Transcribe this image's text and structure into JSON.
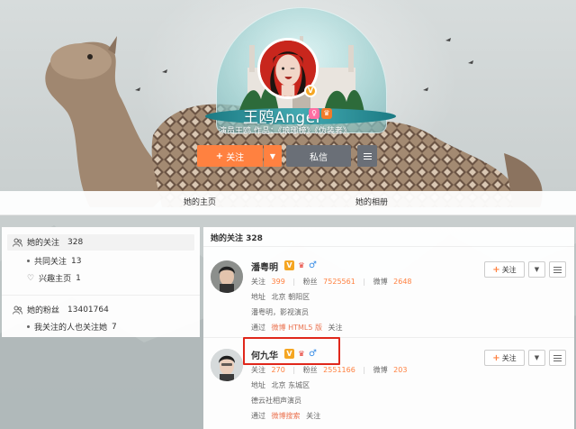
{
  "profile": {
    "name": "王鸥Angel",
    "description": "演员王鸥 作品：《琅琊榜》《伪装者》",
    "follow_label": "关注",
    "follow_plus": "+",
    "message_label": "私信",
    "badge_v": "V"
  },
  "tabs": [
    {
      "label": "她的主页"
    },
    {
      "label": "她的相册"
    }
  ],
  "sidebar": {
    "following_label": "她的关注",
    "following_count": "328",
    "mutual_label": "共同关注",
    "mutual_count": "13",
    "interest_label": "兴趣主页",
    "interest_count": "1",
    "fans_label": "她的粉丝",
    "fans_count": "13401764",
    "fans_sub_label": "我关注的人也关注她",
    "fans_sub_count": "7"
  },
  "main": {
    "title": "她的关注 328",
    "labels": {
      "following": "关注",
      "fans": "粉丝",
      "weibo": "微博",
      "address": "地址",
      "via": "通过",
      "via_suffix": "关注",
      "follow_button": "关注",
      "follow_plus": "+"
    },
    "people": [
      {
        "name": "潘粤明",
        "following": "399",
        "fans": "7525561",
        "weibo": "2648",
        "address": "北京 朝阳区",
        "bio": "潘粤明，影视演员",
        "via": "微博 HTML5 版"
      },
      {
        "name": "何九华",
        "following": "270",
        "fans": "2551166",
        "weibo": "203",
        "address": "北京 东城区",
        "bio": "德云社相声演员",
        "via": "微博搜索"
      }
    ]
  },
  "colors": {
    "accent": "#ff8140",
    "highlight": "#e0271b",
    "male": "#3a8ee6",
    "verified": "#f5a623"
  }
}
